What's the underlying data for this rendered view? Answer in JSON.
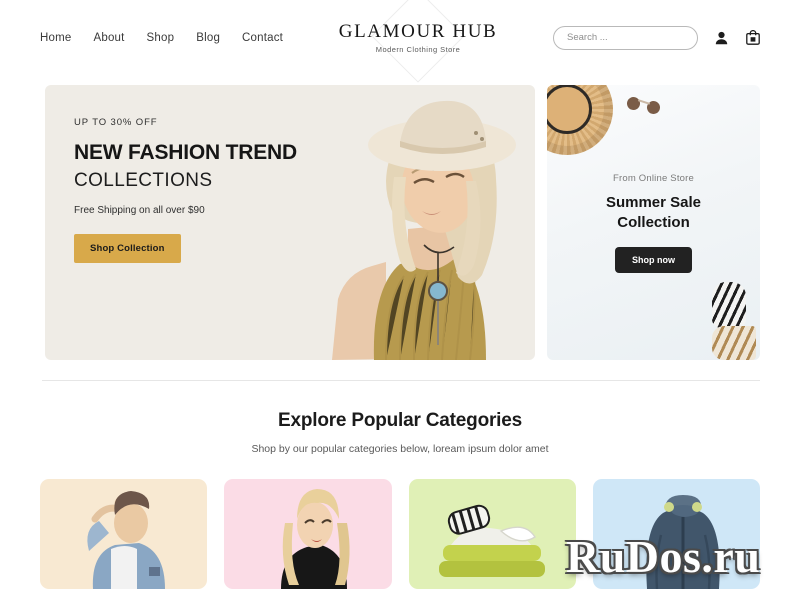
{
  "header": {
    "nav": [
      {
        "label": "Home"
      },
      {
        "label": "About"
      },
      {
        "label": "Shop"
      },
      {
        "label": "Blog"
      },
      {
        "label": "Contact"
      }
    ],
    "brand": {
      "name": "GLAMOUR HUB",
      "tagline": "Modern Clothing Store"
    },
    "search": {
      "placeholder": "Search ...",
      "value": ""
    },
    "icons": {
      "account": "user-icon",
      "cart": "shopping-bag-icon"
    }
  },
  "hero": {
    "left": {
      "kicker": "UP TO 30% OFF",
      "title": "NEW FASHION TREND",
      "subtitle": "COLLECTIONS",
      "note": "Free Shipping on all over $90",
      "button": "Shop Collection",
      "background": "#efece6",
      "button_color": "#d8a94a",
      "image_alt": "blonde-model-in-tan-turtleneck-and-cream-hat"
    },
    "right": {
      "kicker": "From Online Store",
      "title_line1": "Summer Sale",
      "title_line2": "Collection",
      "button": "Shop now",
      "button_color": "#222222",
      "props": [
        "straw-hat",
        "sunglasses",
        "striped-socks"
      ]
    }
  },
  "categories": {
    "title": "Explore Popular Categories",
    "subtitle": "Shop by our popular categories below, loream ipsum dolor amet",
    "cards": [
      {
        "name": "mens-fashion",
        "background": "#f8e9d2",
        "image_alt": "man-in-denim-jacket"
      },
      {
        "name": "womens-fashion",
        "background": "#fbdce6",
        "image_alt": "woman-in-black-turtleneck"
      },
      {
        "name": "knitwear",
        "background": "#e0f0b6",
        "image_alt": "folded-green-sweaters-and-striped-socks"
      },
      {
        "name": "outerwear",
        "background": "#cfe7f7",
        "image_alt": "navy-blue-hooded-jacket"
      }
    ]
  },
  "watermark": {
    "text": "RuDos.ru"
  }
}
